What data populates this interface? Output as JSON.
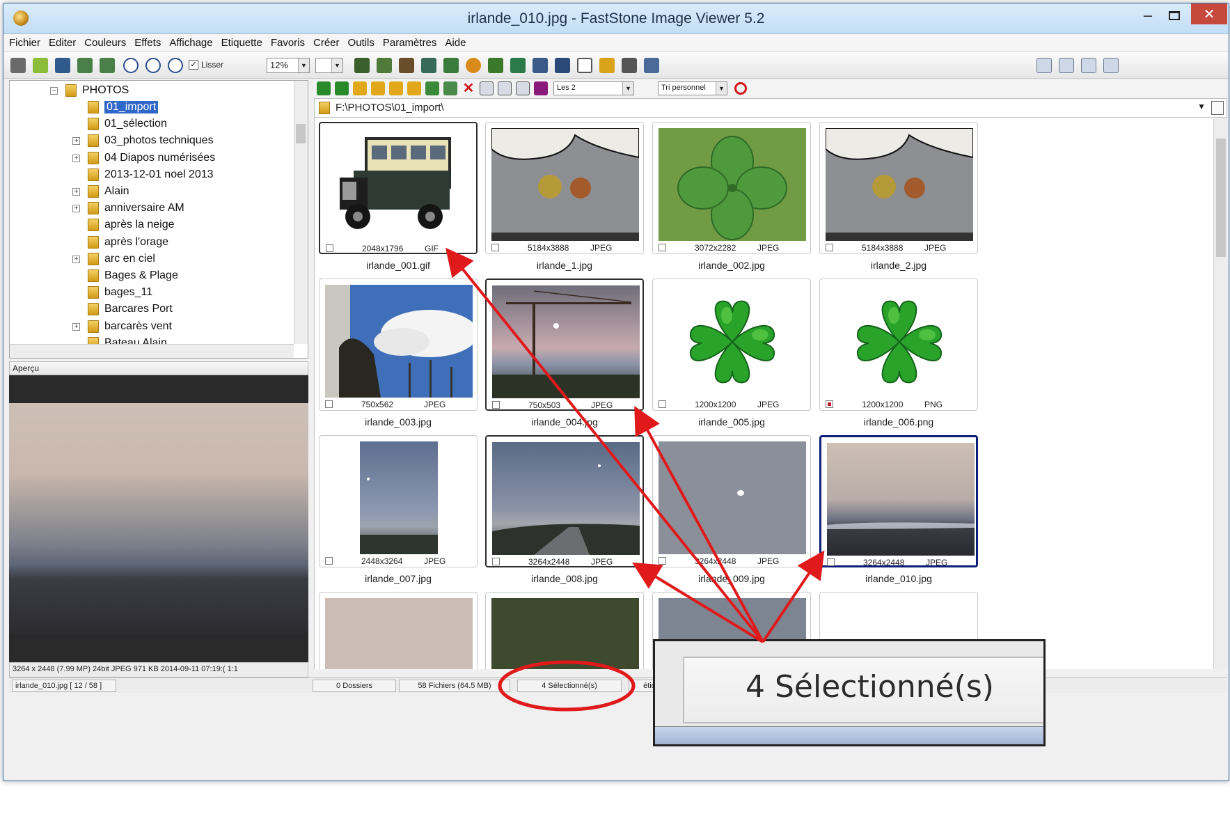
{
  "window": {
    "title": "irlande_010.jpg  -  FastStone Image Viewer 5.2",
    "min_glyph": "–",
    "close_glyph": "✕"
  },
  "menu": [
    "Fichier",
    "Editer",
    "Couleurs",
    "Effets",
    "Affichage",
    "Etiquette",
    "Favoris",
    "Créer",
    "Outils",
    "Paramètres",
    "Aide"
  ],
  "toolbar": {
    "smooth_label": "Lisser",
    "zoom_value": "12%"
  },
  "tree": {
    "root": "PHOTOS",
    "items": [
      {
        "label": "01_import",
        "selected": true,
        "expandable": false
      },
      {
        "label": "01_sélection",
        "expandable": false
      },
      {
        "label": "03_photos techniques",
        "expandable": true
      },
      {
        "label": "04 Diapos numérisées",
        "expandable": true
      },
      {
        "label": "2013-12-01 noel 2013",
        "expandable": false
      },
      {
        "label": "Alain",
        "expandable": true
      },
      {
        "label": "anniversaire AM",
        "expandable": true
      },
      {
        "label": "après la neige",
        "expandable": false
      },
      {
        "label": "après l'orage",
        "expandable": false
      },
      {
        "label": "arc en ciel",
        "expandable": true
      },
      {
        "label": "Bages & Plage",
        "expandable": false
      },
      {
        "label": "bages_11",
        "expandable": false
      },
      {
        "label": "Barcares Port",
        "expandable": false
      },
      {
        "label": "barcarès vent",
        "expandable": true
      },
      {
        "label": "Bateau Alain",
        "expandable": false
      }
    ]
  },
  "preview": {
    "header": "Aperçu",
    "info": "3264 x 2448 (7.99 MP)  24bit  JPEG   971 KB   2014-09-11 07:19:(  1:1"
  },
  "nav": {
    "filter_value": "Les 2",
    "sort_value": "Tri personnel"
  },
  "path": "F:\\PHOTOS\\01_import\\",
  "thumbnails": [
    {
      "name": "irlande_001.gif",
      "dims": "2048x1796",
      "format": "GIF",
      "selected": true,
      "tagged": false,
      "scene": "bus"
    },
    {
      "name": "irlande_1.jpg",
      "dims": "5184x3888",
      "format": "JPEG",
      "selected": false,
      "tagged": false,
      "scene": "coins"
    },
    {
      "name": "irlande_002.jpg",
      "dims": "3072x2282",
      "format": "JPEG",
      "selected": false,
      "tagged": false,
      "scene": "clover-photo"
    },
    {
      "name": "irlande_2.jpg",
      "dims": "5184x3888",
      "format": "JPEG",
      "selected": false,
      "tagged": false,
      "scene": "coins"
    },
    {
      "name": "irlande_003.jpg",
      "dims": "750x562",
      "format": "JPEG",
      "selected": false,
      "tagged": false,
      "scene": "statue"
    },
    {
      "name": "irlande_004.jpg",
      "dims": "750x503",
      "format": "JPEG",
      "selected": true,
      "tagged": false,
      "scene": "crane"
    },
    {
      "name": "irlande_005.jpg",
      "dims": "1200x1200",
      "format": "JPEG",
      "selected": false,
      "tagged": false,
      "scene": "clover-3d"
    },
    {
      "name": "irlande_006.png",
      "dims": "1200x1200",
      "format": "PNG",
      "selected": false,
      "tagged": true,
      "scene": "clover-3d"
    },
    {
      "name": "irlande_007.jpg",
      "dims": "2448x3264",
      "format": "JPEG",
      "selected": false,
      "tagged": false,
      "scene": "portrait-sea"
    },
    {
      "name": "irlande_008.jpg",
      "dims": "3264x2448",
      "format": "JPEG",
      "selected": true,
      "tagged": false,
      "scene": "road-sea"
    },
    {
      "name": "irlande_009.jpg",
      "dims": "3264x2448",
      "format": "JPEG",
      "selected": false,
      "tagged": false,
      "scene": "moon-sky"
    },
    {
      "name": "irlande_010.jpg",
      "dims": "3264x2448",
      "format": "JPEG",
      "selected": true,
      "current": true,
      "tagged": false,
      "scene": "sunset-sea"
    }
  ],
  "statusbar": {
    "current_file": "irlande_010.jpg [ 12 / 58 ]",
    "folders": "0 Dossiers",
    "files": "58 Fichiers (64.5 MB)",
    "selected": "4 Sélectionné(s)",
    "label": "étiq"
  },
  "callout": {
    "text": "4 Sélectionné(s)"
  },
  "annotation_colors": {
    "arrow": "#e0191b",
    "ellipse": "#e0191b"
  }
}
